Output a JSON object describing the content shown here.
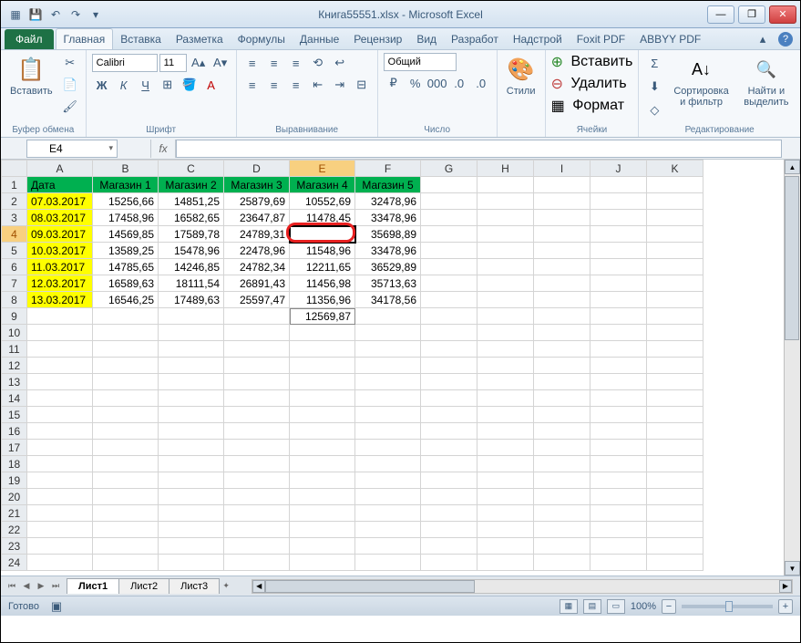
{
  "title": "Книга55551.xlsx - Microsoft Excel",
  "tabs": {
    "file": "Файл",
    "items": [
      "Главная",
      "Вставка",
      "Разметка",
      "Формулы",
      "Данные",
      "Рецензир",
      "Вид",
      "Разработ",
      "Надстрой",
      "Foxit PDF",
      "ABBYY PDF"
    ],
    "active": 0
  },
  "ribbon": {
    "clipboard": {
      "paste": "Вставить",
      "label": "Буфер обмена"
    },
    "font": {
      "name": "Calibri",
      "size": "11",
      "label": "Шрифт"
    },
    "alignment": {
      "label": "Выравнивание"
    },
    "number": {
      "format": "Общий",
      "label": "Число"
    },
    "styles": {
      "btn": "Стили",
      "label": ""
    },
    "cells": {
      "insert": "Вставить",
      "delete": "Удалить",
      "format": "Формат",
      "label": "Ячейки"
    },
    "editing": {
      "sort": "Сортировка и фильтр",
      "find": "Найти и выделить",
      "label": "Редактирование"
    }
  },
  "namebox": "E4",
  "fx": "fx",
  "columns": [
    "A",
    "B",
    "C",
    "D",
    "E",
    "F",
    "G",
    "H",
    "I",
    "J",
    "K"
  ],
  "active_col": "E",
  "active_row": 4,
  "headers": [
    "Дата",
    "Магазин 1",
    "Магазин 2",
    "Магазин 3",
    "Магазин 4",
    "Магазин 5"
  ],
  "rows": [
    {
      "r": 2,
      "date": "07.03.2017",
      "v": [
        "15256,66",
        "14851,25",
        "25879,69",
        "10552,69",
        "32478,96"
      ]
    },
    {
      "r": 3,
      "date": "08.03.2017",
      "v": [
        "17458,96",
        "16582,65",
        "23647,87",
        "11478,45",
        "33478,96"
      ]
    },
    {
      "r": 4,
      "date": "09.03.2017",
      "v": [
        "14569,85",
        "17589,78",
        "24789,31",
        "",
        "35698,89"
      ]
    },
    {
      "r": 5,
      "date": "10.03.2017",
      "v": [
        "13589,25",
        "15478,96",
        "22478,96",
        "11548,96",
        "33478,96"
      ]
    },
    {
      "r": 6,
      "date": "11.03.2017",
      "v": [
        "14785,65",
        "14246,85",
        "24782,34",
        "12211,65",
        "36529,89"
      ]
    },
    {
      "r": 7,
      "date": "12.03.2017",
      "v": [
        "16589,63",
        "18111,54",
        "26891,43",
        "11456,98",
        "35713,63"
      ]
    },
    {
      "r": 8,
      "date": "13.03.2017",
      "v": [
        "16546,25",
        "17489,63",
        "25597,47",
        "11356,96",
        "34178,56"
      ]
    }
  ],
  "overflow_e9": "12569,87",
  "empty_rows": [
    9,
    10,
    11,
    12,
    13,
    14,
    15,
    16,
    17,
    18,
    19,
    20,
    21,
    22,
    23,
    24
  ],
  "sheets": {
    "items": [
      "Лист1",
      "Лист2",
      "Лист3"
    ],
    "active": 0
  },
  "status": {
    "ready": "Готово",
    "zoom": "100%"
  },
  "icons": {
    "excel": "▦",
    "save": "💾",
    "undo": "↶",
    "redo": "↷",
    "dropdown": "▾",
    "min": "—",
    "max": "❐",
    "close": "✕",
    "cut": "✂",
    "copy": "📄",
    "brush": "🖌",
    "bold": "Ж",
    "italic": "К",
    "underline": "Ч",
    "sigma": "Σ",
    "fill": "⬇",
    "clear": "◇",
    "sort_icon": "A↓",
    "find_icon": "🔍"
  }
}
